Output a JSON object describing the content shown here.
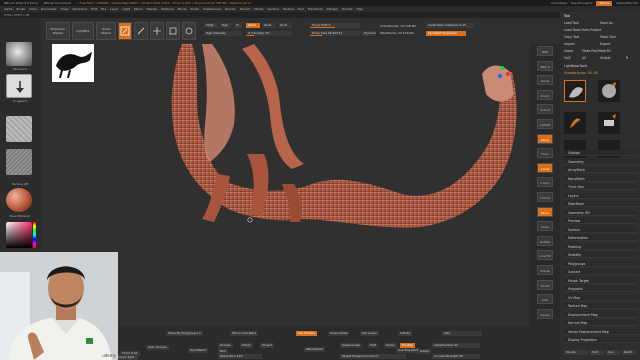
{
  "title_bar": {
    "app": "ZBrush 2022.0.6 [x1s]",
    "document": "ZBrush Document",
    "stats": "• Free Mem 1.986GB • Active Mem 6807 • Scratch Disk 4724 • Timer 0.007 • PolyCount 21.738 MP • MeshCount 11",
    "quicksave": "QuickSave",
    "see_through": "See-through 0",
    "menus": "Menus",
    "default_script": "DefaultZScript"
  },
  "menu_bar": [
    "Alpha",
    "Brush",
    "Color",
    "Document",
    "Draw",
    "Dynamics",
    "Edit",
    "File",
    "Layer",
    "Light",
    "Macro",
    "Marker",
    "Material",
    "Movie",
    "Picker",
    "Preferences",
    "Render",
    "Stencil",
    "Stroke",
    "Surface",
    "Texture",
    "Tool",
    "Transform",
    "Zplugin",
    "Zscript",
    "Help"
  ],
  "subtitle": "CTRL+SHIFT+TB",
  "left_tray": {
    "brush_label": "Standard",
    "stroke_label": "DragRect",
    "alpha_label": "Alpha Off",
    "texture_label": "Texture Off",
    "material_label": "BasicMaterial",
    "gradient_label": "Gradient",
    "switch_label": "SwitchColor",
    "alternate_label": "Alternate"
  },
  "top_shelf": {
    "projection_master": "Projection Master",
    "lightbox": "LightBox",
    "quick_sketch": "Quick Sketch",
    "edit": "Edit",
    "draw": "Draw",
    "move": "Move",
    "scale": "Scale",
    "rotate": "Rotate",
    "mrgb": "Mrgb",
    "rgb": "Rgb",
    "m": "M",
    "zadd": "Zadd",
    "zsub": "Zsub",
    "zcut": "Zcut",
    "z_intensity": "Z Intensity 18",
    "rgb_intensity": "Rgb Intensity",
    "focal_shift": "Focal Shift 0",
    "draw_size": "Draw Size 96.82372",
    "dynamic": "Dynamic",
    "active_points": "ActivePoints: 14.748 Mil",
    "total_points": "TotalPoints: 23.718 Mil",
    "calibration": "Calibration Distance 0.25",
    "spotlight": "Spotlight Projection"
  },
  "right_tray": {
    "tool_header": "Tool",
    "load_tool": "Load Tool",
    "save_as": "Save As",
    "load_tools_project": "Load Tools From Project",
    "copy_tool": "Copy Tool",
    "paste_tool": "Paste Tool",
    "import": "Import",
    "export": "Export",
    "clone": "Clone",
    "make_polymesh": "Make PolyMesh3D",
    "goz": "GoZ",
    "all": "All",
    "visible": "Visible",
    "r": "R",
    "lightbox_tools": "Lightbox▸Tools",
    "current_tool": "Unwrap.fr.mo. 19. 48",
    "tools": [
      "Unwrap.fr.mo",
      "SphereBrush",
      "SimpleBrush",
      "EraserBrush",
      "Unwrap.fr.mo",
      "Unwrap.fr.mo"
    ],
    "subpalettes": [
      "Subtool",
      "Geometry",
      "ArrayMesh",
      "NanoMesh",
      "Thick Skin",
      "Layers",
      "FiberMesh",
      "Geometry HD",
      "Preview",
      "Surface",
      "Deformation",
      "Masking",
      "Visibility",
      "Polygroups",
      "Contact",
      "Morph Target",
      "Polypaint",
      "UV Map",
      "Texture Map",
      "Displacement Map",
      "Normal Map",
      "Vector Displacement Map",
      "Display Properties"
    ],
    "bottom_label": "Divide",
    "smt": "Smt",
    "suv": "Suv",
    "rsmt": "ReUV"
  },
  "right_strip": [
    "BPR",
    "SPix 3",
    "Scroll",
    "Zoom",
    "Actual",
    "AAHalf",
    "Persp",
    "Floor",
    "Local",
    "L.Sym",
    "Frame",
    "Move",
    "Scale",
    "Rotate",
    "Line Fill PolyF",
    "Transp",
    "Ghost",
    "Solo",
    "Xpose"
  ],
  "bottom_shelf": {
    "mask_by_polygroups": "Mask By Polygroups 0",
    "mirror_and_weld": "Mirror And Weld",
    "del_hidden": "Del Hidden",
    "close_holes": "Close Holes",
    "del_lower": "Del Lower",
    "sdiv": "SDiv",
    "infinite": "Infinite",
    "size": "Size",
    "auto_groups": "Auto Groups",
    "dynamesh": "DynaMesh",
    "groups": "Groups",
    "polish": "Polish",
    "blur": "Blur",
    "project": "Project",
    "resolution": "Resolution 128",
    "zremesher": "ZRemesher",
    "keep_groups": "KeepGroups",
    "half": "Half",
    "same": "Same",
    "double": "Double",
    "adapt": "Adapt",
    "target_polygons": "Target Polygons Count 5",
    "use_polypaint": "Use Polypaint",
    "adaptive_size": "AdaptiveSize 50",
    "curves_strength": "Curves Strength 50",
    "thick": "Thick 0.02",
    "group_split": "Groups Split"
  },
  "webcam": {
    "shirt_logo": "udemy"
  }
}
